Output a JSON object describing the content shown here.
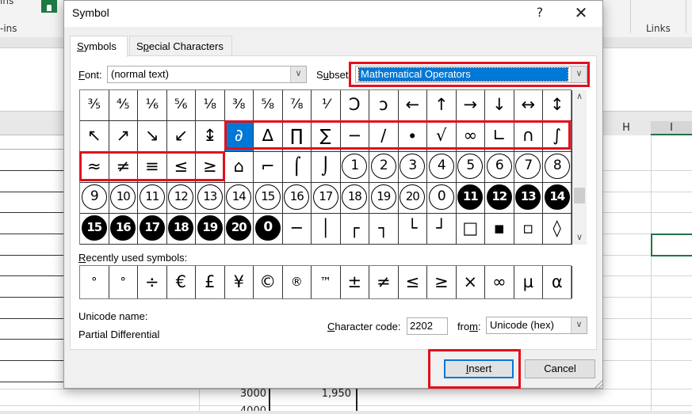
{
  "excel": {
    "ribbon_left_top": "ins",
    "ribbon_left_group": "-ins",
    "ribbon_links_group": "Links",
    "column_headers": [
      "H",
      "I"
    ],
    "cells": [
      {
        "value": "3000"
      },
      {
        "value": "1,950"
      },
      {
        "value": "4000"
      }
    ]
  },
  "dialog": {
    "title": "Symbol",
    "help_label": "?",
    "close_label": "✕",
    "tabs": [
      {
        "label_pre": "",
        "label_ul": "S",
        "label_post": "ymbols",
        "active": true
      },
      {
        "label_pre": "S",
        "label_ul": "p",
        "label_post": "ecial Characters",
        "active": false
      }
    ],
    "font": {
      "label_ul": "F",
      "label_post": "ont:",
      "value": "(normal text)"
    },
    "subset": {
      "label_pre": "S",
      "label_ul": "u",
      "label_post": "bset:",
      "value": "Mathematical Operators"
    },
    "symbols_grid": [
      [
        "⅗",
        "⅘",
        "⅙",
        "⅚",
        "⅛",
        "⅜",
        "⅝",
        "⅞",
        "⅟",
        "Ↄ",
        "ↄ",
        "←",
        "↑",
        "→",
        "↓",
        "↔",
        "↕"
      ],
      [
        "↖",
        "↗",
        "↘",
        "↙",
        "↨",
        "∂",
        "∆",
        "∏",
        "∑",
        "−",
        "∕",
        "∙",
        "√",
        "∞",
        "∟",
        "∩",
        "∫"
      ],
      [
        "≈",
        "≠",
        "≡",
        "≤",
        "≥",
        "⌂",
        "⌐",
        "⌠",
        "⌡",
        "①",
        "②",
        "③",
        "④",
        "⑤",
        "⑥",
        "⑦",
        "⑧"
      ],
      [
        "⑨",
        "⑩",
        "⑪",
        "⑫",
        "⑬",
        "⑭",
        "⑮",
        "⑯",
        "⑰",
        "⑱",
        "⑲",
        "⑳",
        "⓪",
        "⓫",
        "⓬",
        "⓭",
        "⓮"
      ],
      [
        "⓯",
        "⓰",
        "⓱",
        "⓲",
        "⓳",
        "⓴",
        "⓿",
        "─",
        "│",
        "┌",
        "┐",
        "└",
        "┘",
        "□",
        "▪",
        "▫",
        "◊"
      ]
    ],
    "selected_symbol": "∂",
    "recent_label_ul": "R",
    "recent_label_post": "ecently used symbols:",
    "recent_symbols": [
      "°",
      "°",
      "÷",
      "€",
      "£",
      "¥",
      "©",
      "®",
      "™",
      "±",
      "≠",
      "≤",
      "≥",
      "×",
      "∞",
      "µ",
      "α"
    ],
    "unicode_name_label": "Unicode name:",
    "unicode_name_value": "Partial Differential",
    "char_code": {
      "label_ul": "C",
      "label_post": "haracter code:",
      "value": "2202"
    },
    "from": {
      "label_pre": "fro",
      "label_ul": "m",
      "label_post": ":",
      "value": "Unicode (hex)"
    },
    "buttons": {
      "insert_ul": "I",
      "insert_post": "nsert",
      "cancel": "Cancel"
    },
    "highlight_color": "#e2101d",
    "accent_color": "#0078d7"
  }
}
